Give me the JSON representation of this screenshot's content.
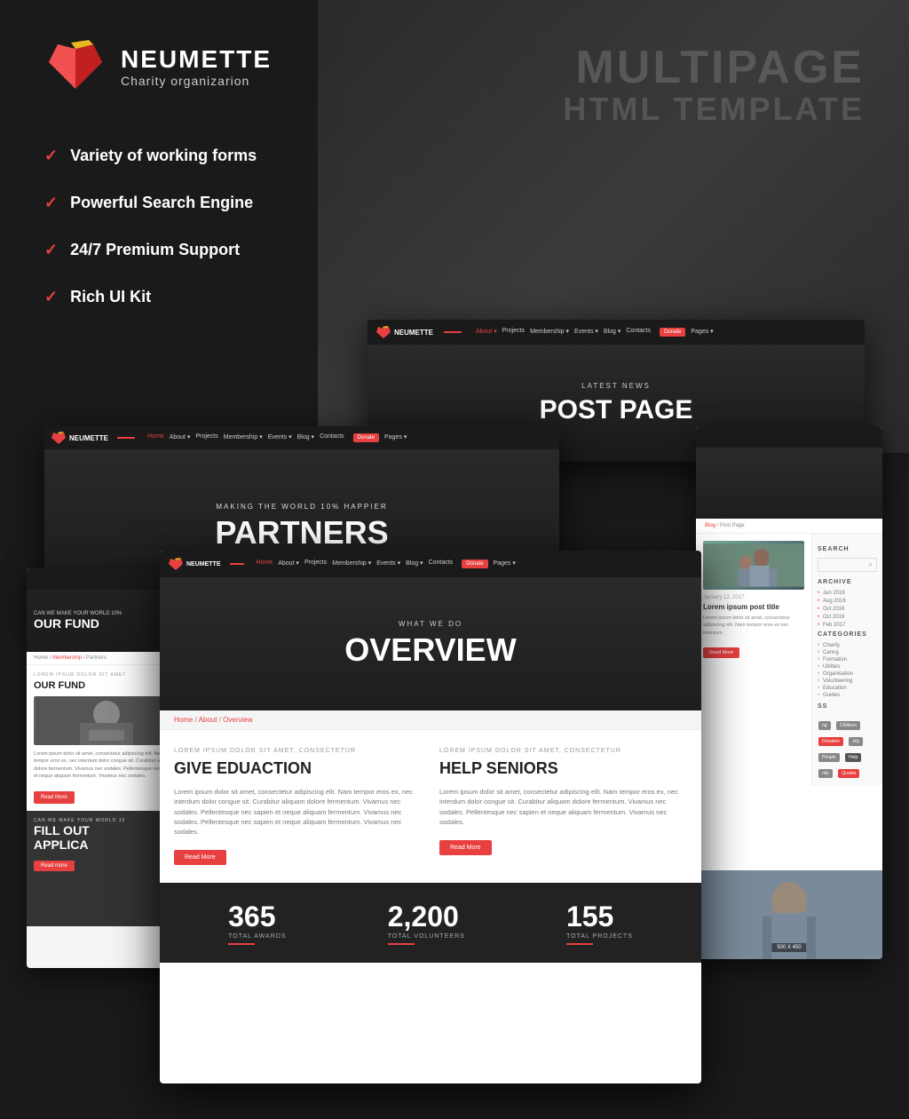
{
  "brand": {
    "name": "NEUMETTE",
    "tagline": "Charity organizarion"
  },
  "multipage": {
    "line1": "MULTIPAGE",
    "line2": "HTML TEMPLATE"
  },
  "features": [
    {
      "id": "variety",
      "text": "Variety of working forms"
    },
    {
      "id": "search",
      "text": "Powerful Search Engine"
    },
    {
      "id": "support",
      "text": "24/7 Premium Support"
    },
    {
      "id": "ui",
      "text": "Rich UI Kit"
    }
  ],
  "nav": {
    "links": [
      "Home",
      "About ▾",
      "Projects",
      "Membership ▾",
      "Events ▾",
      "Blog ▾",
      "Contacts",
      "Donate",
      "Pages ▾"
    ],
    "donate": "Donate"
  },
  "postPage": {
    "latest_news": "LATEST NEWS",
    "title": "POST PAGE"
  },
  "partnersPage": {
    "subtitle": "MAKING THE WORLD 10% HAPPIER",
    "title": "PARTNERS"
  },
  "overviewPage": {
    "what_we_do": "WHAT WE DO",
    "title": "OVERVIEW",
    "breadcrumb": "Home / About / Overview",
    "col1": {
      "lorem": "LOREM IPSUM DOLOR SIT AMET, CONSECTETUR",
      "heading": "GIVE EDUACTION",
      "body": "Lorem ipsum dolor sit amet, consectetur adipiscing elit. Nam tempor eros ex, nec interdum dolor congue sit. Curabitur aliquam dolore fermentum. Vivamus nec sodales. Pellentesque nec sapien et neque aliquam fermentum. Vivamus nec sodales. Pellentesque nec sapien et neque aliquam fermentum. Vivamus nec sodales.",
      "btn": "Read More"
    },
    "col2": {
      "lorem": "LOREM IPSUM DOLOR SIT AMET, CONSECTETUR",
      "heading": "HELP SENIORS",
      "body": "Lorem ipsum dolor sit amet, consectetur adipiscing elit. Nam tempor eros ex, nec interdum dolor congue sit. Curabitur aliquam dolore fermentum. Vivamus nec sodales. Pellentesque nec sapien et neque aliquam fermentum. Vivamus nec sodales.",
      "btn": "Read More"
    }
  },
  "stats": [
    {
      "number": "365",
      "label": "TOTAL AWARDS"
    },
    {
      "number": "2,200",
      "label": "TOTAL VOLUNTEERS"
    },
    {
      "number": "155",
      "label": "TOTAL PROJECTS"
    }
  ],
  "fundPage": {
    "subtitle": "CAN WE MAKE YOUR WORLD 10%",
    "title": "OUR FUND",
    "fill_subtitle": "CAN WE MAKE YOUR WORLD 10",
    "fill_title": "FILL OUT\nAPPLICA",
    "read_more": "Read More",
    "read_more2": "Read more"
  },
  "blogSidebar": {
    "search_label": "SEARCH",
    "archive_label": "ARCHIVE",
    "archive_items": [
      "Jun 2016",
      "Aug 2016",
      "Oct 2016",
      "Oct 2016",
      "Feb 2017"
    ],
    "categories_label": "CATEGORIES",
    "categories": [
      "Charity",
      "Caring",
      "Formation",
      "Utilities",
      "Organisation",
      "Volunteering",
      "Education",
      "Guides"
    ],
    "tags_label": "SS",
    "tags": [
      {
        "text": "ng",
        "color": "gray"
      },
      {
        "text": "Children",
        "color": "gray"
      },
      {
        "text": "Donation",
        "color": "red"
      },
      {
        "text": "nity",
        "color": "gray"
      },
      {
        "text": "People",
        "color": "gray"
      },
      {
        "text": "Help",
        "color": "dark"
      },
      {
        "text": "nity",
        "color": "gray"
      },
      {
        "text": "Quotes",
        "color": "red"
      }
    ],
    "photo_label": "500 X 450"
  }
}
